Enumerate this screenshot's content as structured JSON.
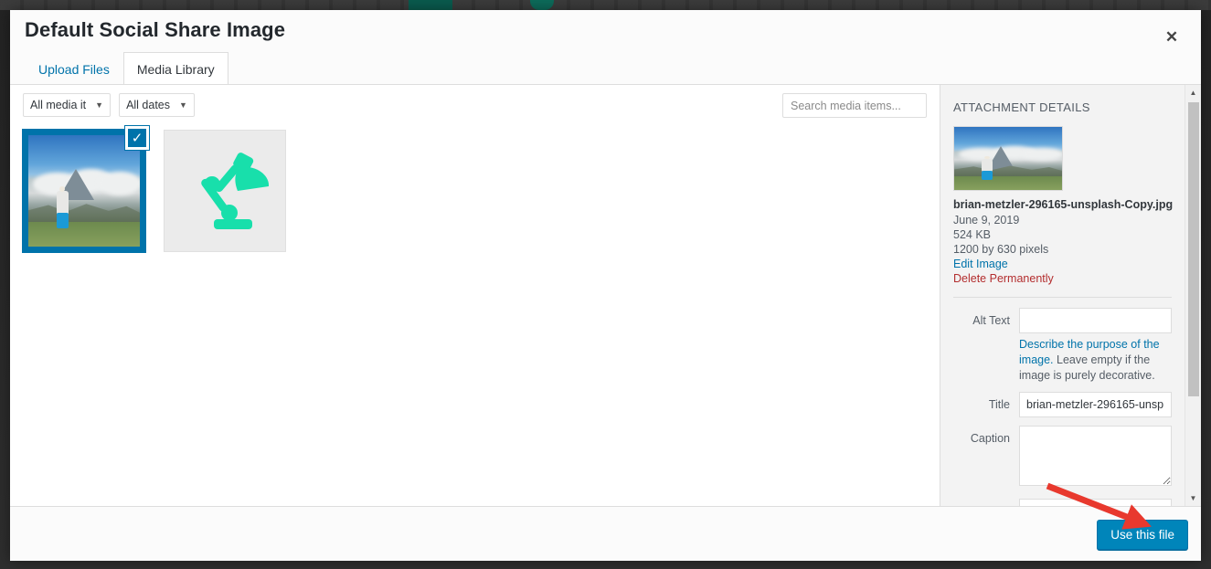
{
  "modal": {
    "title": "Default Social Share Image",
    "close_icon": "close-icon",
    "tabs": [
      {
        "label": "Upload Files",
        "active": false
      },
      {
        "label": "Media Library",
        "active": true
      }
    ]
  },
  "toolbar": {
    "media_filter": "All media it",
    "date_filter": "All dates",
    "caret_icon": "chevron-down-icon",
    "search_placeholder": "Search media items...",
    "search_value": ""
  },
  "grid": {
    "items": [
      {
        "name": "mountain-runner-photo",
        "selected": true,
        "check_icon": "check-icon"
      },
      {
        "name": "desk-lamp-icon",
        "selected": false
      }
    ]
  },
  "sidebar": {
    "heading": "ATTACHMENT DETAILS",
    "filename": "brian-metzler-296165-unsplash-Copy.jpg",
    "date": "June 9, 2019",
    "filesize": "524 KB",
    "dimensions": "1200 by 630 pixels",
    "edit_link": "Edit Image",
    "delete_link": "Delete Permanently",
    "fields": {
      "alt_text_label": "Alt Text",
      "alt_text_value": "",
      "alt_help_link": "Describe the purpose of the image.",
      "alt_help_rest": " Leave empty if the image is purely decorative.",
      "title_label": "Title",
      "title_value": "brian-metzler-296165-unsp",
      "caption_label": "Caption",
      "caption_value": ""
    },
    "scrollbar": {
      "up_icon": "triangle-up-icon",
      "down_icon": "triangle-down-icon"
    }
  },
  "footer": {
    "use_button": "Use this file"
  },
  "colors": {
    "accent": "#0073aa",
    "button": "#0085ba",
    "danger": "#b32d2e",
    "annotation": "#e8392e",
    "lamp": "#18dfab"
  }
}
